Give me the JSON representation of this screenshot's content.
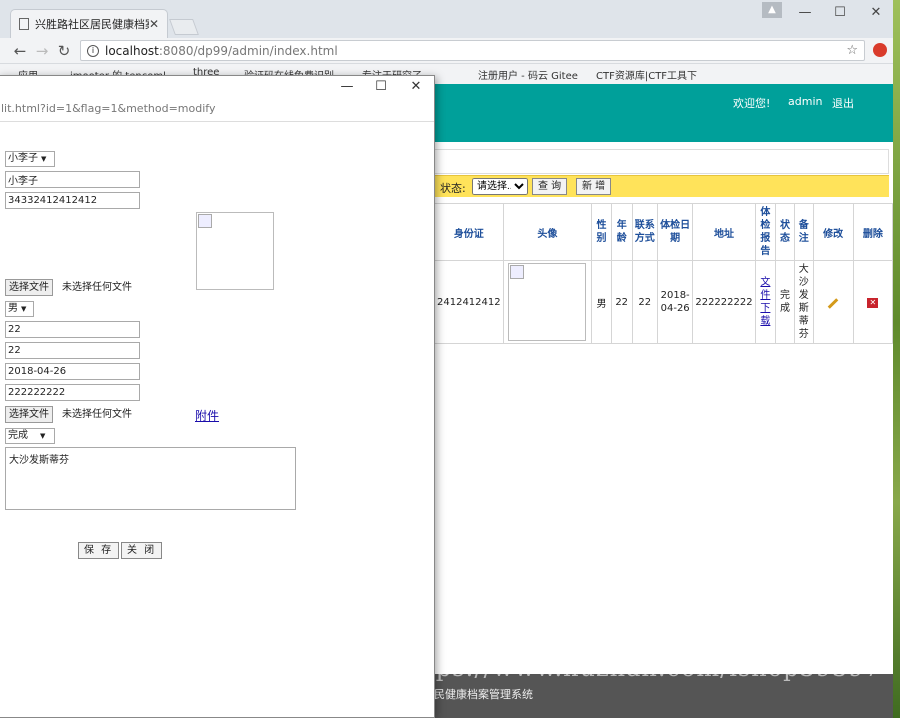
{
  "browser": {
    "tab_title": "兴胜路社区居民健康档案",
    "url_host": "localhost",
    "url_path": ":8080/dp99/admin/index.html",
    "bookmarks": [
      "应用",
      "imooter 的 tencoml...",
      "three",
      "验证码在线免费识别...",
      "专注于研究了...",
      "注册用户 - 码云 Gitee",
      "CTF资源库|CTF工具下"
    ]
  },
  "header": {
    "welcome": "欢迎您!",
    "user": "admin",
    "logout": "退出"
  },
  "filter": {
    "status_label": "状态:",
    "status_value": "请选择...",
    "query_button": "查 询",
    "add_button": "新 增"
  },
  "table": {
    "headers": [
      "身份证",
      "头像",
      "性别",
      "年龄",
      "联系方式",
      "体检日期",
      "地址",
      "体检报告",
      "状态",
      "备注",
      "修改",
      "删除"
    ],
    "row": {
      "idcard": "2412412412",
      "gender": "男",
      "age": "22",
      "contact": "22",
      "date": "2018-04-26",
      "address": "222222222",
      "report": "文件下载",
      "status": "完成",
      "remark": "大沙发斯蒂芬"
    }
  },
  "footer": {
    "text": "民健康档案管理系统"
  },
  "watermark": "https://www.huzhan.com/ishop39397",
  "popup": {
    "url": "lit.html?id=1&flag=1&method=modify",
    "name_select": "小李子",
    "name": "小李子",
    "idcard": "34332412412412",
    "file_button": "选择文件",
    "no_file": "未选择任何文件",
    "gender": "男",
    "age": "22",
    "contact": "22",
    "date": "2018-04-26",
    "address": "222222222",
    "file_button2": "选择文件",
    "no_file2": "未选择任何文件",
    "attachment": "附件",
    "status": "完成",
    "remark": "大沙发斯蒂芬",
    "save_button": "保 存",
    "close_button": "关 闭"
  }
}
